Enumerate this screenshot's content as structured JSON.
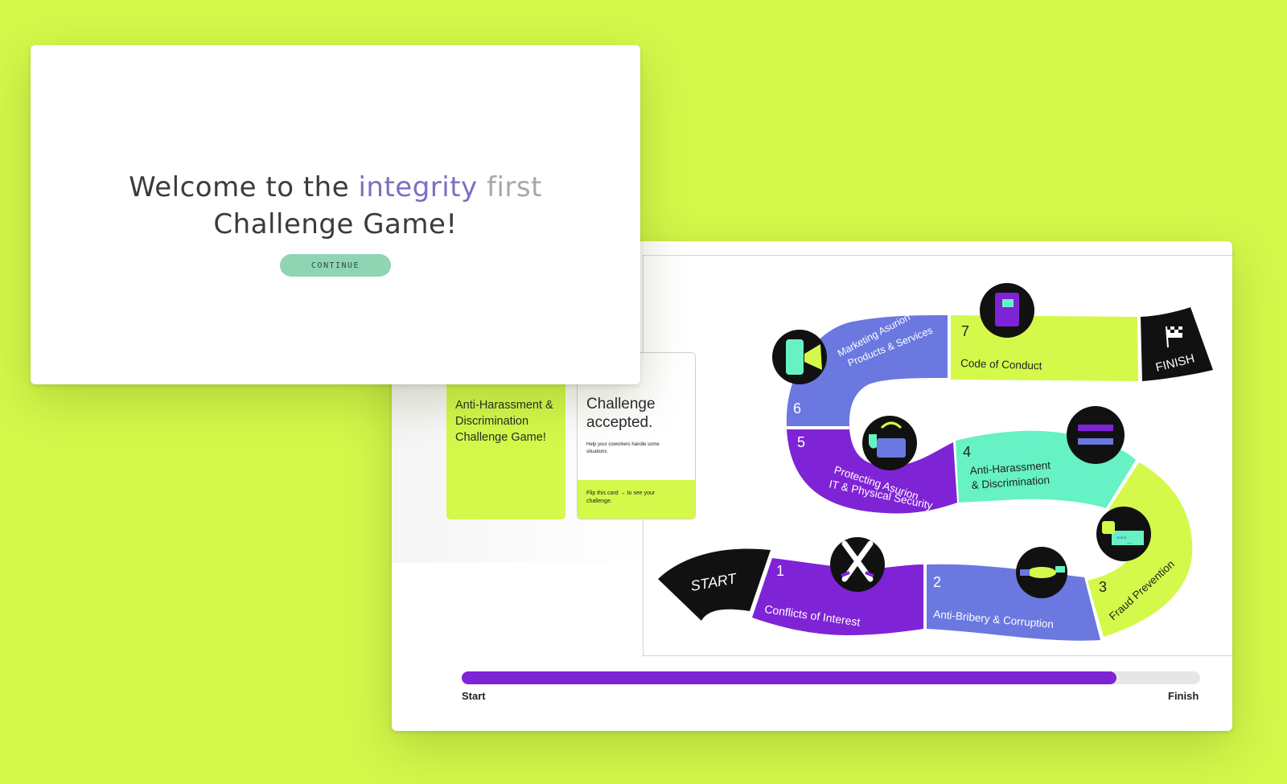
{
  "welcome": {
    "title_part1": "Welcome to the ",
    "title_integrity": "integrity",
    "title_first": " first",
    "title_line2": "Challenge Game!",
    "continue_label": "CONTINUE"
  },
  "cards": {
    "card_a_text": "Anti-Harassment & Discrimination Challenge Game!",
    "card_b_heading": "Challenge accepted.",
    "card_b_sub": "Help your coworkers handle some situations.",
    "card_b_footer": "Flip this card → to see your challenge."
  },
  "board": {
    "start_label": "START",
    "finish_label": "FINISH",
    "spaces": [
      {
        "number": "1",
        "label": "Conflicts of Interest",
        "color": "#7f23d6",
        "icon": "crossed-swords-icon"
      },
      {
        "number": "2",
        "label": "Anti-Bribery & Corruption",
        "color": "#6a78e0",
        "icon": "handshake-money-icon"
      },
      {
        "number": "3",
        "label": "Fraud Prevention",
        "color": "#d4f94a",
        "icon": "password-lock-icon"
      },
      {
        "number": "4",
        "label_line1": "Anti-Harassment",
        "label_line2": "& Discrimination",
        "color": "#66f2c4",
        "icon": "equals-icon"
      },
      {
        "number": "5",
        "label_line1": "Protecting Asurion",
        "label_line2": "IT & Physical Security",
        "color": "#7f23d6",
        "icon": "security-card-icon"
      },
      {
        "number": "6",
        "label_line1": "Marketing Asurion",
        "label_line2": "Products & Services",
        "color": "#6a78e0",
        "icon": "phone-megaphone-icon"
      },
      {
        "number": "7",
        "label": "Code of Conduct",
        "color": "#d4f94a",
        "icon": "notebook-check-icon"
      }
    ]
  },
  "progress": {
    "value": 0.887,
    "start_label": "Start",
    "finish_label": "Finish",
    "fill_color": "#7f23d6"
  }
}
